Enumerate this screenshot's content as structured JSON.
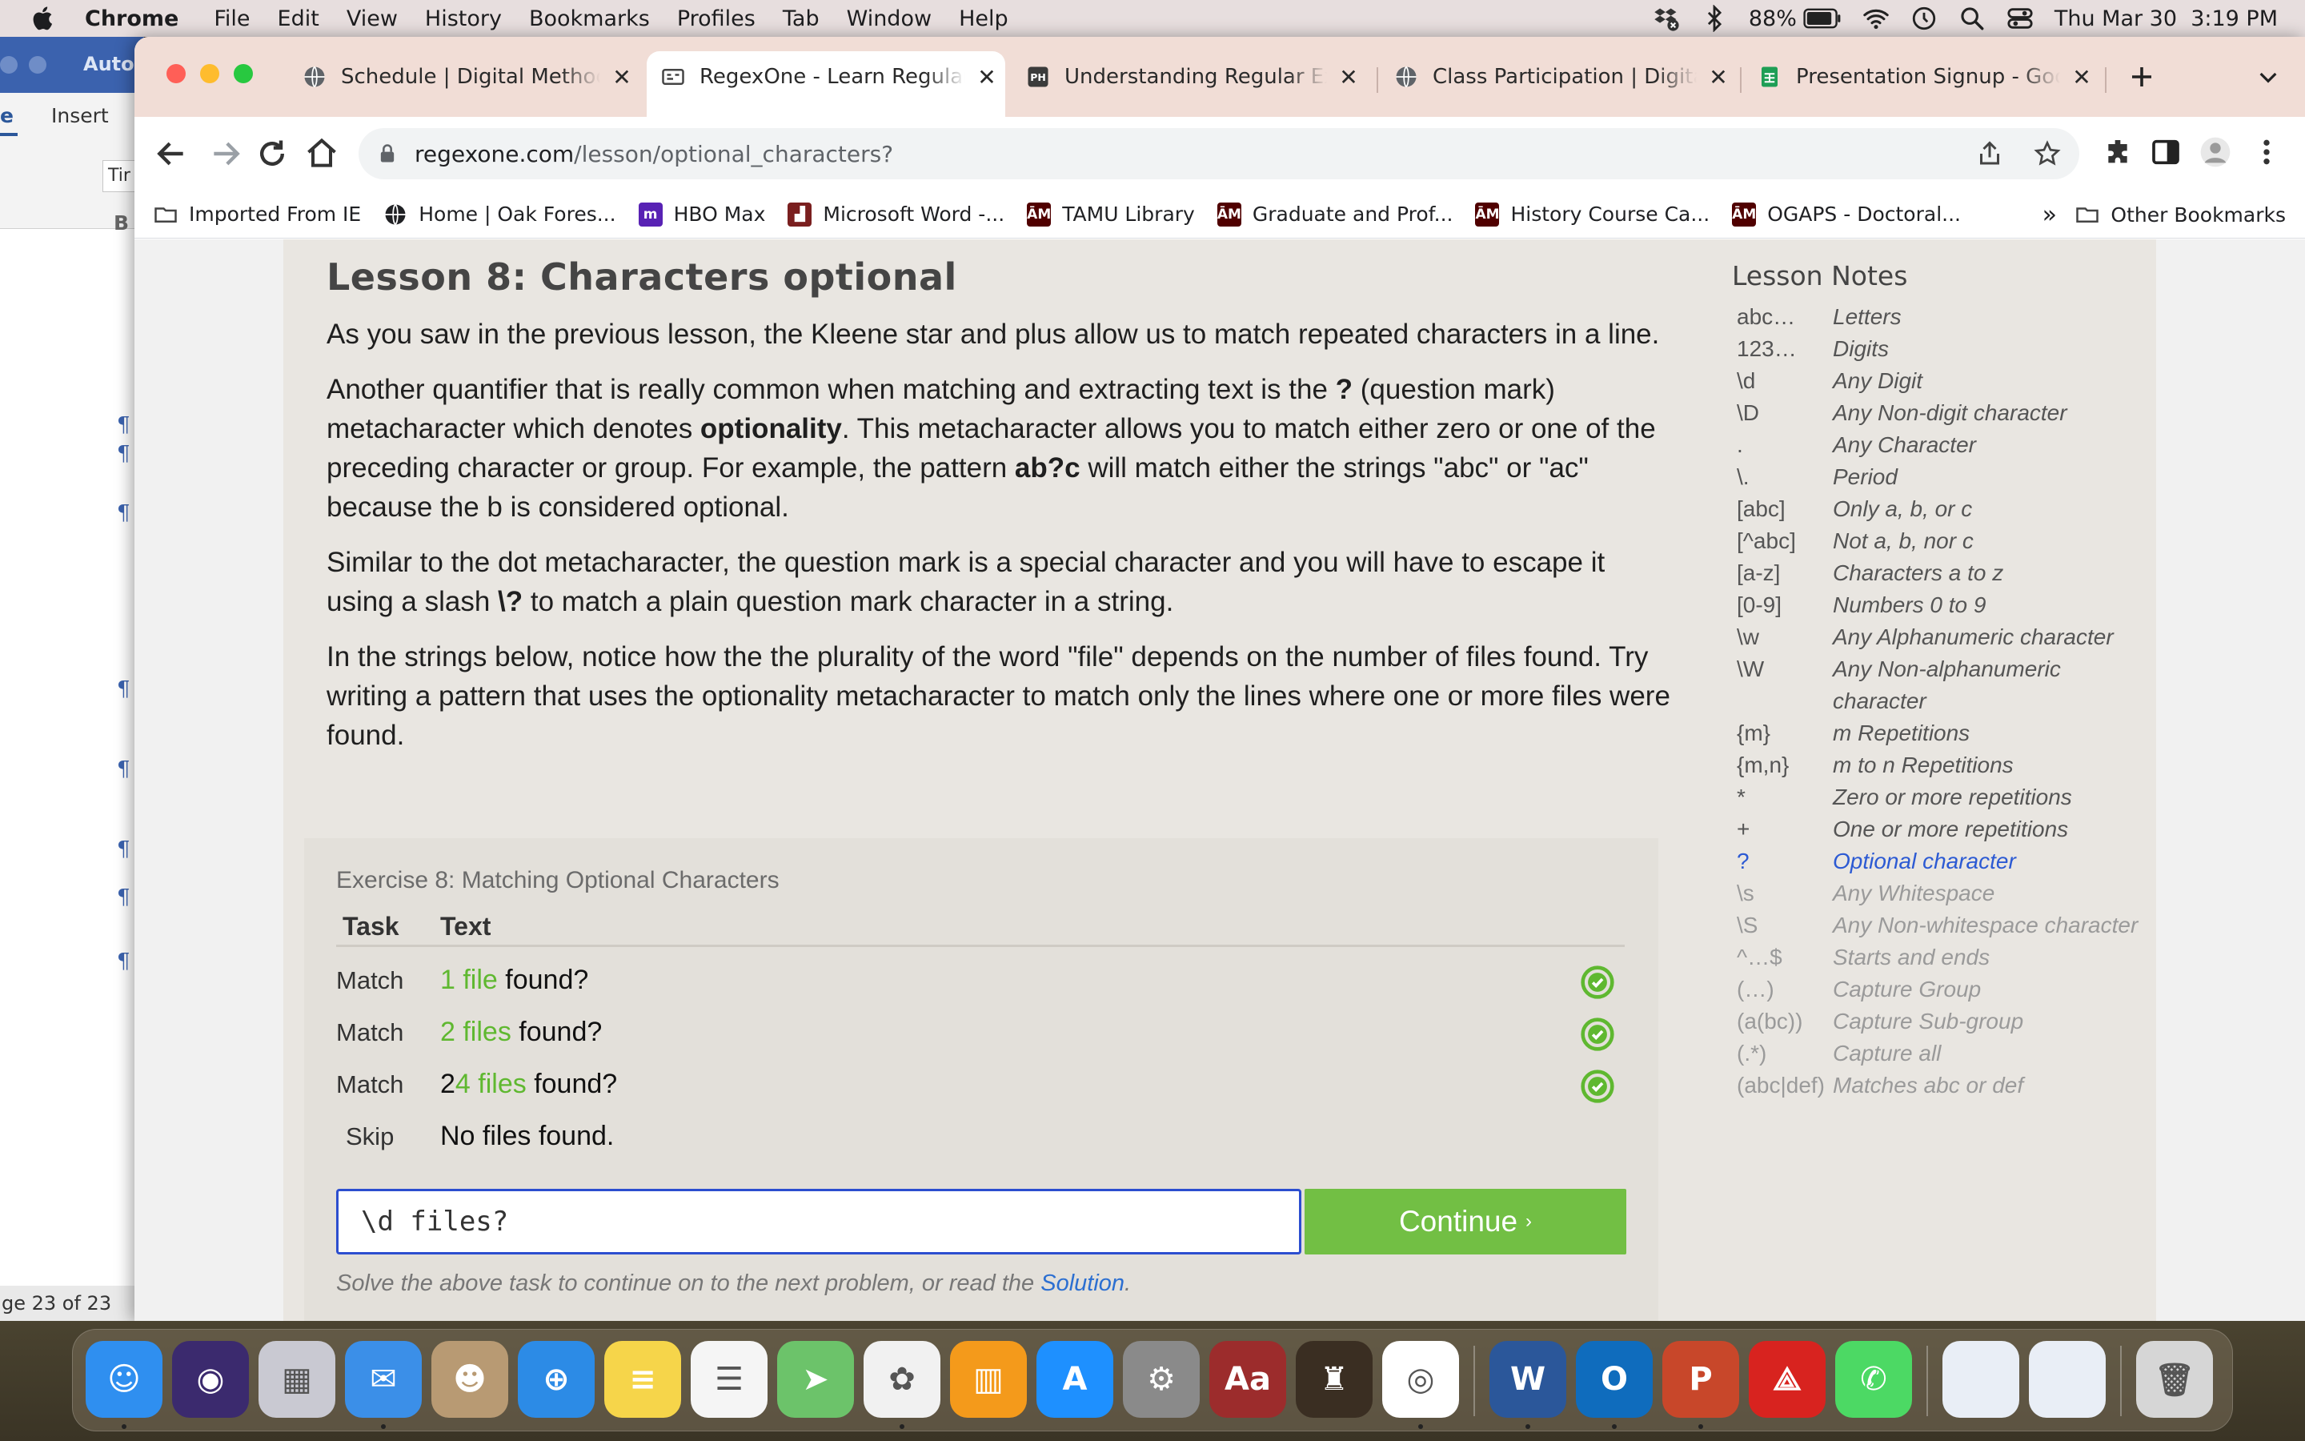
{
  "menubar": {
    "app_name": "Chrome",
    "items": [
      "File",
      "Edit",
      "View",
      "History",
      "Bookmarks",
      "Profiles",
      "Tab",
      "Window",
      "Help"
    ],
    "battery": "88%",
    "datetime": "Thu Mar 30  3:19 PM"
  },
  "word_window": {
    "title_fragment": "AutoS",
    "tab_e": "e",
    "tab_insert": "Insert",
    "font_fragment": "Tir",
    "status": "ge 23 of 23"
  },
  "browser": {
    "tabs": [
      {
        "label": "Schedule | Digital Methods fo",
        "icon": "globe-icon"
      },
      {
        "label": "RegexOne - Learn Regular Ex",
        "icon": "regexone-icon",
        "active": true
      },
      {
        "label": "Understanding Regular Expre",
        "icon": "ph-icon"
      },
      {
        "label": "Class Participation | Digital M",
        "icon": "globe-icon"
      },
      {
        "label": "Presentation Signup - Google",
        "icon": "sheets-icon"
      }
    ],
    "url_host": "regexone.com",
    "url_path": "/lesson/optional_characters?",
    "bookmarks": [
      {
        "label": "Imported From IE",
        "icon": "folder-icon"
      },
      {
        "label": "Home | Oak Fores...",
        "icon": "globe-icon"
      },
      {
        "label": "HBO Max",
        "icon": "hbo-icon"
      },
      {
        "label": "Microsoft Word -...",
        "icon": "word-icon"
      },
      {
        "label": "TAMU Library",
        "icon": "tamu-icon"
      },
      {
        "label": "Graduate and Prof...",
        "icon": "tamu-icon"
      },
      {
        "label": "History Course Ca...",
        "icon": "tamu-icon"
      },
      {
        "label": "OGAPS - Doctoral...",
        "icon": "tamu-icon"
      }
    ],
    "bookmarks_overflow": "»",
    "other_bookmarks": "Other Bookmarks"
  },
  "lesson": {
    "title": "Lesson 8: Characters optional",
    "p1": "As you saw in the previous lesson, the Kleene star and plus allow us to match repeated characters in a line.",
    "p2_a": "Another quantifier that is really common when matching and extracting text is the ",
    "p2_b": "?",
    "p2_c": " (question mark) metacharacter which denotes ",
    "p2_d": "optionality",
    "p2_e": ". This metacharacter allows you to match either zero or one of the preceding character or group. For example, the pattern ",
    "p2_f": "ab?c",
    "p2_g": " will match either the strings \"abc\" or \"ac\" because the b is considered optional.",
    "p3_a": "Similar to the dot metacharacter, the question mark is a special character and you will have to escape it using a slash ",
    "p3_b": "\\?",
    "p3_c": " to match a plain question mark character in a string.",
    "p4": "In the strings below, notice how the the plurality of the word \"file\" depends on the number of files found. Try writing a pattern that uses the optionality metacharacter to match only the lines where one or more files were found."
  },
  "exercise": {
    "title": "Exercise 8: Matching Optional Characters",
    "col_task": "Task",
    "col_text": "Text",
    "rows": [
      {
        "task": "Match",
        "pre": "",
        "hl": "1 file",
        "post": " found?",
        "status": "check-icon"
      },
      {
        "task": "Match",
        "pre": "",
        "hl": "2 files",
        "post": " found?",
        "status": "check-icon"
      },
      {
        "task": "Match",
        "pre": "2",
        "hl": "4 files",
        "post": " found?",
        "status": "check-icon"
      },
      {
        "task": "Skip",
        "pre": "No files found.",
        "hl": "",
        "post": "",
        "status": ""
      }
    ],
    "input_value": "\\d files?",
    "continue_label": "Continue",
    "continue_chevron": "›",
    "solve_prefix": "Solve the above task to continue on to the next problem, or read the ",
    "solve_link": "Solution",
    "solve_suffix": "."
  },
  "notes": {
    "title": "Lesson Notes",
    "items": [
      {
        "sym": "abc…",
        "desc": "Letters",
        "state": "done"
      },
      {
        "sym": "123…",
        "desc": "Digits",
        "state": "done"
      },
      {
        "sym": "\\d",
        "desc": "Any Digit",
        "state": "done"
      },
      {
        "sym": "\\D",
        "desc": "Any Non-digit character",
        "state": "done"
      },
      {
        "sym": ".",
        "desc": "Any Character",
        "state": "done"
      },
      {
        "sym": "\\.",
        "desc": "Period",
        "state": "done"
      },
      {
        "sym": "[abc]",
        "desc": "Only a, b, or c",
        "state": "done"
      },
      {
        "sym": "[^abc]",
        "desc": "Not a, b, nor c",
        "state": "done"
      },
      {
        "sym": "[a-z]",
        "desc": "Characters a to z",
        "state": "done"
      },
      {
        "sym": "[0-9]",
        "desc": "Numbers 0 to 9",
        "state": "done"
      },
      {
        "sym": "\\w",
        "desc": "Any Alphanumeric character",
        "state": "done"
      },
      {
        "sym": "\\W",
        "desc": "Any Non-alphanumeric character",
        "state": "done"
      },
      {
        "sym": "{m}",
        "desc": "m Repetitions",
        "state": "done"
      },
      {
        "sym": "{m,n}",
        "desc": "m to n Repetitions",
        "state": "done"
      },
      {
        "sym": "*",
        "desc": "Zero or more repetitions",
        "state": "done"
      },
      {
        "sym": "+",
        "desc": "One or more repetitions",
        "state": "done"
      },
      {
        "sym": "?",
        "desc": "Optional character",
        "state": "current"
      },
      {
        "sym": "\\s",
        "desc": "Any Whitespace",
        "state": "future"
      },
      {
        "sym": "\\S",
        "desc": "Any Non-whitespace character",
        "state": "future"
      },
      {
        "sym": "^…$",
        "desc": "Starts and ends",
        "state": "future"
      },
      {
        "sym": "(…)",
        "desc": "Capture Group",
        "state": "future"
      },
      {
        "sym": "(a(bc))",
        "desc": "Capture Sub-group",
        "state": "future"
      },
      {
        "sym": "(.*)",
        "desc": "Capture all",
        "state": "future"
      },
      {
        "sym": "(abc|def)",
        "desc": "Matches abc or def",
        "state": "future"
      }
    ]
  },
  "dock": {
    "apps": [
      {
        "name": "finder",
        "color": "#2f8ff0",
        "glyph": "☺"
      },
      {
        "name": "siri",
        "color": "#3b2a6e",
        "glyph": "◉"
      },
      {
        "name": "launchpad",
        "color": "#c9c9d2",
        "glyph": "▦"
      },
      {
        "name": "mail",
        "color": "#3b8fe8",
        "glyph": "✉"
      },
      {
        "name": "contacts",
        "color": "#b89a73",
        "glyph": "☻"
      },
      {
        "name": "safari",
        "color": "#2c8be6",
        "glyph": "⊕"
      },
      {
        "name": "notes",
        "color": "#f6d54a",
        "glyph": "≡"
      },
      {
        "name": "reminders",
        "color": "#f5f5f5",
        "glyph": "☰"
      },
      {
        "name": "maps",
        "color": "#6cc36a",
        "glyph": "➤"
      },
      {
        "name": "photos",
        "color": "#f1f1f1",
        "glyph": "✿"
      },
      {
        "name": "books",
        "color": "#f49a1b",
        "glyph": "▥"
      },
      {
        "name": "app-store",
        "color": "#1e90ff",
        "glyph": "A"
      },
      {
        "name": "system-preferences",
        "color": "#8a8a8a",
        "glyph": "⚙"
      },
      {
        "name": "dictionary",
        "color": "#9c2c2c",
        "glyph": "Aa"
      },
      {
        "name": "medieval-ii",
        "color": "#3a2e22",
        "glyph": "♜"
      },
      {
        "name": "chrome",
        "color": "#ffffff",
        "glyph": "◎"
      },
      {
        "name": "word",
        "color": "#2b579a",
        "glyph": "W"
      },
      {
        "name": "outlook",
        "color": "#0f6cbd",
        "glyph": "O"
      },
      {
        "name": "powerpoint",
        "color": "#c8472a",
        "glyph": "P"
      },
      {
        "name": "acrobat",
        "color": "#d8231f",
        "glyph": "⟁"
      },
      {
        "name": "messages",
        "color": "#4cd964",
        "glyph": "✆"
      },
      {
        "name": "doc-thumbnail-1",
        "color": "#e9eef6",
        "glyph": ""
      },
      {
        "name": "doc-thumbnail-2",
        "color": "#e9eef6",
        "glyph": ""
      },
      {
        "name": "trash",
        "color": "#d6d6d6",
        "glyph": "🗑"
      }
    ]
  }
}
